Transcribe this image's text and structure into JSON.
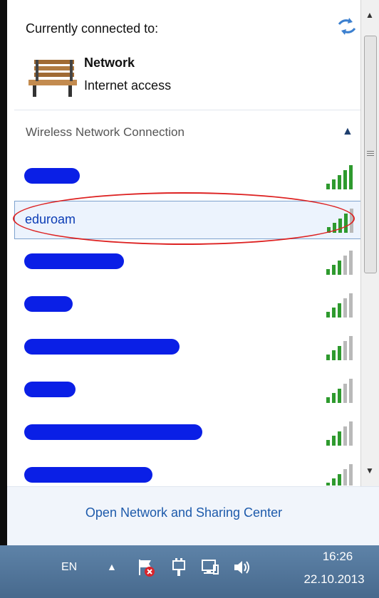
{
  "header": {
    "title": "Currently connected to:"
  },
  "connected": {
    "name": "Network",
    "status": "Internet access"
  },
  "section": {
    "title": "Wireless Network Connection"
  },
  "networks": [
    {
      "label": "",
      "redacted": true
    },
    {
      "label": "eduroam",
      "redacted": false,
      "selected": true
    },
    {
      "label": "",
      "redacted": true
    },
    {
      "label": "",
      "redacted": true
    },
    {
      "label": "",
      "redacted": true
    },
    {
      "label": "",
      "redacted": true
    },
    {
      "label": "",
      "redacted": true
    },
    {
      "label": "",
      "redacted": true
    }
  ],
  "footer": {
    "link": "Open Network and Sharing Center"
  },
  "taskbar": {
    "language": "EN",
    "time": "16:26",
    "date": "22.10.2013"
  },
  "colors": {
    "link": "#1d5aab",
    "selected_bg": "#ecf3fd",
    "annotation": "#dd2222"
  }
}
